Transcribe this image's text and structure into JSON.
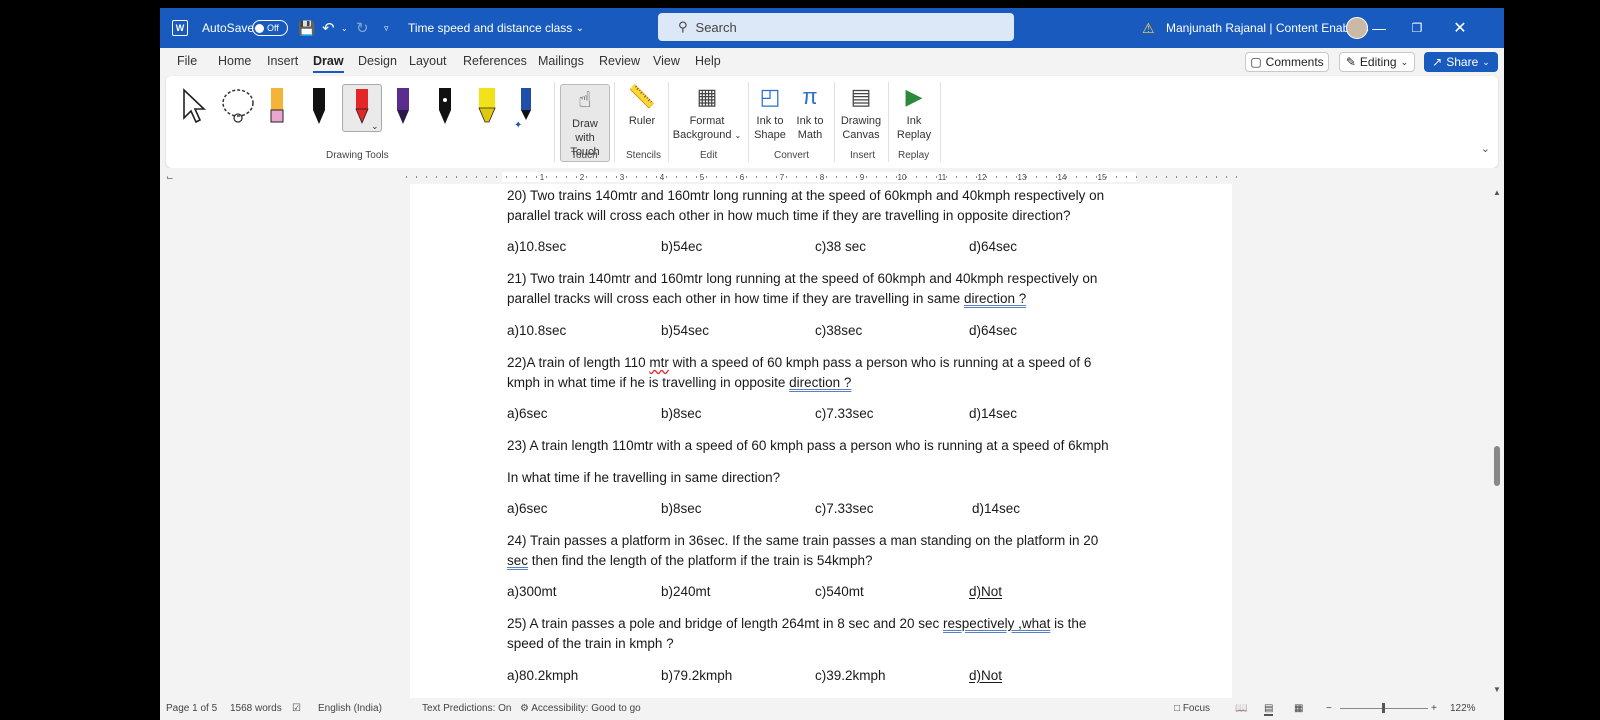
{
  "titlebar": {
    "autosave_label": "AutoSave",
    "autosave_state": "Off",
    "doc_title": "Time speed and distance class",
    "search_placeholder": "Search",
    "user": "Manjunath Rajanal | Content Enablers"
  },
  "menu": {
    "tabs": [
      "File",
      "Home",
      "Insert",
      "Draw",
      "Design",
      "Layout",
      "References",
      "Mailings",
      "Review",
      "View",
      "Help"
    ],
    "active": "Draw",
    "comments": "Comments",
    "editing": "Editing",
    "share": "Share"
  },
  "ribbon": {
    "drawing_tools_label": "Drawing Tools",
    "draw_with_touch": [
      "Draw with",
      "Touch"
    ],
    "ruler": "Ruler",
    "format_background": [
      "Format",
      "Background"
    ],
    "ink_to_shape": [
      "Ink to",
      "Shape"
    ],
    "ink_to_math": [
      "Ink to",
      "Math"
    ],
    "drawing_canvas": [
      "Drawing",
      "Canvas"
    ],
    "ink_replay": [
      "Ink",
      "Replay"
    ],
    "groups": {
      "touch": "Touch",
      "stencils": "Stencils",
      "edit": "Edit",
      "convert": "Convert",
      "insert": "Insert",
      "replay": "Replay"
    },
    "pen_colors": [
      "#e9c0d8",
      "#111111",
      "#e32626",
      "#5a2d8c",
      "#111111",
      "#f2e21a",
      "#1f4fa8"
    ]
  },
  "ruler_numbers": [
    "1",
    "2",
    "3",
    "4",
    "5",
    "6",
    "7",
    "8",
    "9",
    "10",
    "11",
    "12",
    "13",
    "14",
    "15"
  ],
  "document": {
    "q20": {
      "line1": "20) Two trains 140mtr and 160mtr long running at the speed of 60kmph and 40kmph respectively on",
      "line2": "parallel track will cross each other in how much time if they are travelling in opposite direction?",
      "options": [
        "a)10.8sec",
        "b)54ec",
        "c)38 sec",
        "d)64sec"
      ]
    },
    "q21": {
      "line1": "21) Two train 140mtr and 160mtr long running at the speed of 60kmph and 40kmph respectively on",
      "line2_a": "parallel tracks will cross each other in how time if they are travelling in same ",
      "line2_b": "direction ?",
      "options": [
        "a)10.8sec",
        "b)54sec",
        "c)38sec",
        "d)64sec"
      ]
    },
    "q22": {
      "line1_a": "22)A train of length 110 ",
      "line1_b": "mtr",
      "line1_c": " with a speed of 60 kmph pass a person who is running at a speed of 6",
      "line2_a": "kmph in what time if he is travelling in opposite ",
      "line2_b": "direction ?",
      "options": [
        "a)6sec",
        "b)8sec",
        "c)7.33sec",
        "d)14sec"
      ]
    },
    "q23": {
      "line1": "23) A train length 110mtr with a speed of 60 kmph pass a person who is running at a speed of 6kmph",
      "line2": "In what time if he travelling in same direction?",
      "options": [
        "a)6sec",
        "b)8sec",
        "c)7.33sec",
        "d)14sec"
      ]
    },
    "q24": {
      "line1": "24) Train passes a platform in 36sec. If the same train passes a man standing on the platform in 20",
      "line2_a": "sec",
      "line2_b": " then find the length of the platform if the train is 54kmph?",
      "options": [
        "a)300mt",
        "b)240mt",
        "c)540mt",
        "d)Not"
      ]
    },
    "q25": {
      "line1_a": "25) A train passes a pole and bridge of length 264mt in 8 sec and 20 sec ",
      "line1_b": "respectively ,what",
      "line1_c": " is the",
      "line2": "speed of the train in kmph ?",
      "options": [
        "a)80.2kmph",
        "b)79.2kmph",
        "c)39.2kmph",
        "d)Not"
      ]
    }
  },
  "statusbar": {
    "page": "Page 1 of 5",
    "words": "1568 words",
    "language": "English (India)",
    "text_predictions": "Text Predictions: On",
    "accessibility": "Accessibility: Good to go",
    "focus": "Focus",
    "zoom": "122%"
  },
  "colors": {
    "titlebar": "#185abd",
    "accent": "#185abd"
  }
}
